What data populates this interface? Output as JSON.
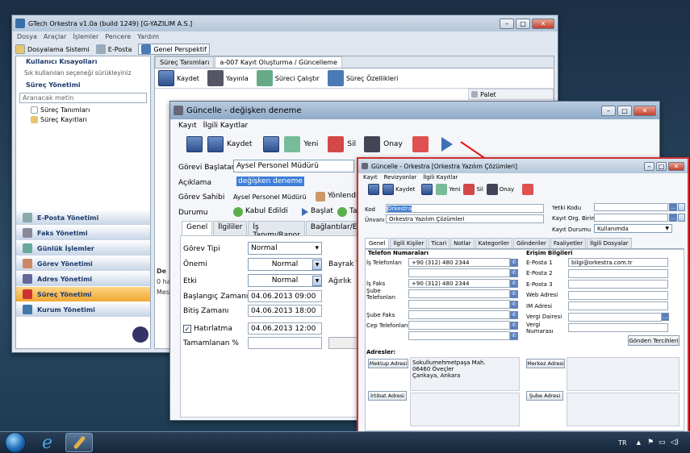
{
  "main_window": {
    "title": "GTech Orkestra v1.0a (build 1249) [G-YAZILIM A.S.]",
    "menu": [
      "Dosya",
      "Araçlar",
      "İşlemler",
      "Pencere",
      "Yardım"
    ],
    "toolbar": [
      "Dosyalama Sistemi",
      "E-Posta",
      "Genel Perspektif"
    ],
    "sidebar": {
      "shortcuts_title": "Kullanıcı Kısayolları",
      "shortcuts_hint": "Sık kullanılan seçeneği sürükleyiniz",
      "process_title": "Süreç Yönetimi",
      "search_placeholder": "Aranacak metin",
      "tree": [
        "Süreç Tanımları",
        "Süreç Kayıtları"
      ],
      "nav": [
        "E-Posta Yönetimi",
        "Faks Yönetimi",
        "Günlük İşlemler",
        "Görev Yönetimi",
        "Adres Yönetimi",
        "Süreç Yönetimi",
        "Kurum Yönetimi"
      ]
    },
    "tabs": [
      "Süreç Tanımları",
      "a-007 Kayıt Oluşturma / Güncelleme"
    ],
    "tab_toolbar": [
      "Kaydet",
      "Yayınla",
      "Süreci Çalıştır",
      "Süreç Özellikleri"
    ],
    "palette": "Palet",
    "fragments": [
      "De",
      "0 hata",
      "Mes"
    ]
  },
  "mid_window": {
    "title": "Güncelle - değişken deneme",
    "menu": [
      "Kayıt",
      "İlgili Kayıtlar"
    ],
    "toolbar": [
      "Kaydet",
      "Yeni",
      "Sil",
      "Onay"
    ],
    "fields": {
      "gorev_baslatan_label": "Görevi Başlatan",
      "gorev_baslatan": "Aysel Personel Müdürü",
      "aciklama_label": "Açıklama",
      "aciklama": "değişken deneme",
      "gorev_sahibi_label": "Görev Sahibi",
      "gorev_sahibi": "Aysel Personel Müdürü",
      "yonlendir": "Yönlendi",
      "durumu_label": "Durumu",
      "durumu": "Kabul Edildi",
      "baslat": "Başlat",
      "ta": "Ta"
    },
    "tabs": [
      "Genel",
      "İlgililer",
      "İş Tanımı/Rapor",
      "Bağlantılar/Eklent"
    ],
    "form": {
      "gorev_tipi_label": "Görev Tipi",
      "gorev_tipi": "Normal",
      "onemi_label": "Önemi",
      "onemi": "Normal",
      "bayrak": "Bayrak T",
      "etki_label": "Etki",
      "etki": "Normal",
      "agirlik": "Ağırlık",
      "baslangic_label": "Başlangıç Zamanı",
      "baslangic": "04.06.2013 09:00",
      "bitis_label": "Bitiş Zamanı",
      "bitis": "04.06.2013 18:00",
      "hatirlatma_label": "Hatırlatma",
      "hatirlatma": "04.06.2013 12:00",
      "tamamlanan_label": "Tamamlanan %"
    }
  },
  "front_window": {
    "title": "Güncelle - Orkestra [Orkestra Yazılım Çözümleri]",
    "menu": [
      "Kayıt",
      "Revizyonlar",
      "İlgili Kayıtlar"
    ],
    "toolbar": [
      "Kaydet",
      "Yeni",
      "Sil",
      "Onay"
    ],
    "kod_label": "Kod",
    "kod": "Orkestra",
    "unvan_label": "Ünvanı",
    "unvan": "Orkestra Yazılım Çözümleri",
    "yetki_kodu_label": "Yetki Kodu",
    "kayit_org_label": "Kayıt Org. Birimi",
    "kayit_durumu_label": "Kayıt Durumu",
    "kayit_durumu": "Kullanımda",
    "tabs": [
      "Genel",
      "İlgili Kişiler",
      "Ticari",
      "Notlar",
      "Kategoriler",
      "Gönderiler",
      "Faaliyetler",
      "İlgili Dosyalar"
    ],
    "telefon_title": "Telefon Numaraları",
    "phones": [
      {
        "label": "İş Telefonları",
        "value": "+90 (312) 480 2344"
      },
      {
        "label": "",
        "value": ""
      },
      {
        "label": "İş Faks",
        "value": "+90 (312) 480 2344"
      },
      {
        "label": "Şube Telefonları",
        "value": ""
      },
      {
        "label": "",
        "value": ""
      },
      {
        "label": "Şube Faks",
        "value": ""
      },
      {
        "label": "Cep Telefonları",
        "value": ""
      },
      {
        "label": "",
        "value": ""
      }
    ],
    "erisim_title": "Erişim Bilgileri",
    "access": [
      {
        "label": "E-Posta 1",
        "value": "bilgi@orkestra.com.tr"
      },
      {
        "label": "E-Posta 2",
        "value": ""
      },
      {
        "label": "E-Posta 3",
        "value": ""
      },
      {
        "label": "Web Adresi",
        "value": ""
      },
      {
        "label": "IM Adresi",
        "value": ""
      },
      {
        "label": "Vergi Dairesi",
        "value": ""
      },
      {
        "label": "Vergi Numarası",
        "value": ""
      }
    ],
    "gonderi_btn": "Gönderi Tercihleri",
    "adresler_title": "Adresler:",
    "mektup_btn": "Mektup Adresi",
    "address_lines": [
      "Sokullumehmetpaşa Mah.",
      "06460 Öveçler",
      "Çankaya, Ankara"
    ],
    "merkez_btn": "Merkez Adresi",
    "irtibat_btn": "İrtibat Adresi",
    "sube_btn": "Şube Adresi"
  },
  "taskbar": {
    "lang": "TR"
  }
}
